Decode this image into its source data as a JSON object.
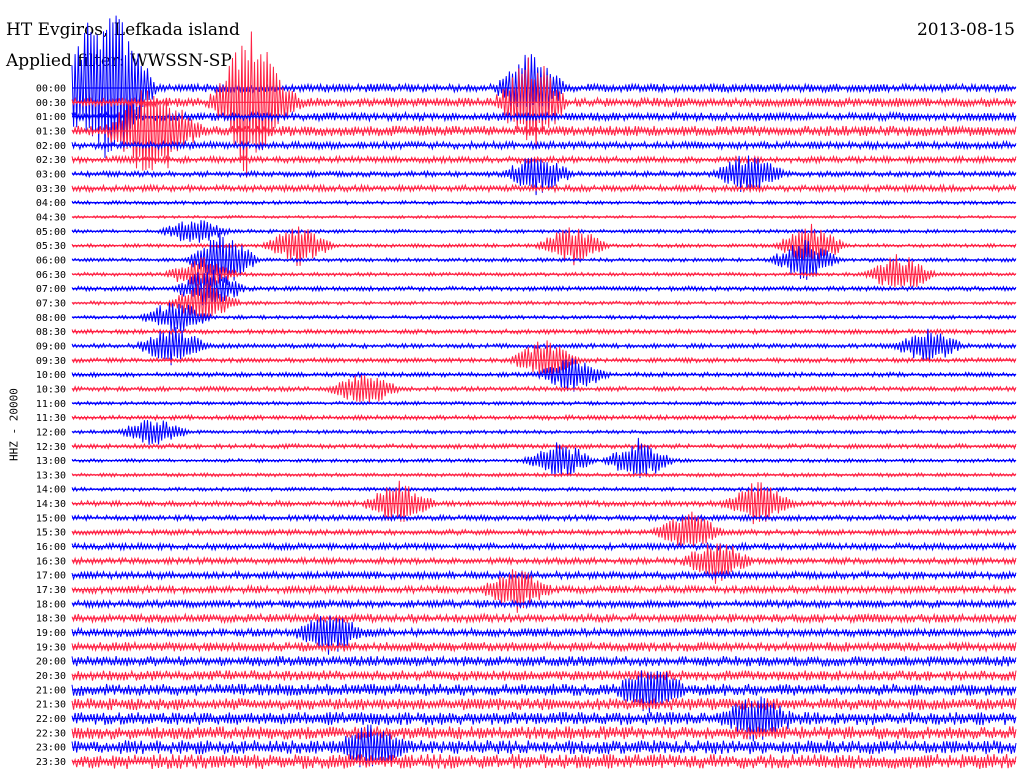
{
  "header": {
    "station": "HT Evgiros, Lefkada island",
    "date": "2013-08-15",
    "filter": "Applied filter: WWSSN-SP"
  },
  "chart_data": {
    "type": "line",
    "title": "HT Evgiros, Lefkada island",
    "ylabel": "HHZ - 20000",
    "row_labels": [
      "00:00",
      "00:30",
      "01:00",
      "01:30",
      "02:00",
      "02:30",
      "03:00",
      "03:30",
      "04:00",
      "04:30",
      "05:00",
      "05:30",
      "06:00",
      "06:30",
      "07:00",
      "07:30",
      "08:00",
      "08:30",
      "09:00",
      "09:30",
      "10:00",
      "10:30",
      "11:00",
      "11:30",
      "12:00",
      "12:30",
      "13:00",
      "13:30",
      "14:00",
      "14:30",
      "15:00",
      "15:30",
      "16:00",
      "16:30",
      "17:00",
      "17:30",
      "18:00",
      "18:30",
      "19:00",
      "19:30",
      "20:00",
      "20:30",
      "21:00",
      "21:30",
      "22:00",
      "22:30",
      "23:00",
      "23:30"
    ],
    "series_colors": [
      "#0000ff",
      "#ff2244"
    ],
    "row_window_minutes": 30,
    "noise_level": [
      0.45,
      0.5,
      0.45,
      0.55,
      0.4,
      0.35,
      0.3,
      0.35,
      0.2,
      0.15,
      0.2,
      0.2,
      0.2,
      0.2,
      0.25,
      0.2,
      0.2,
      0.25,
      0.25,
      0.25,
      0.25,
      0.25,
      0.2,
      0.25,
      0.2,
      0.25,
      0.2,
      0.2,
      0.2,
      0.3,
      0.3,
      0.3,
      0.35,
      0.35,
      0.4,
      0.4,
      0.4,
      0.45,
      0.45,
      0.5,
      0.55,
      0.55,
      0.65,
      0.65,
      0.7,
      0.7,
      0.75,
      0.8
    ],
    "events": [
      {
        "row": 0,
        "minute": 0.5,
        "amp": 8
      },
      {
        "row": 0,
        "minute": 1.5,
        "amp": 6
      },
      {
        "row": 0,
        "minute": 1.5,
        "amp": 5
      },
      {
        "row": 1,
        "minute": 5.5,
        "amp": 9
      },
      {
        "row": 1,
        "minute": 6.2,
        "amp": 4
      },
      {
        "row": 1,
        "minute": 14.6,
        "amp": 7
      },
      {
        "row": 0,
        "minute": 14.6,
        "amp": 5
      },
      {
        "row": 3,
        "minute": 2.2,
        "amp": 5
      },
      {
        "row": 3,
        "minute": 3,
        "amp": 4
      },
      {
        "row": 6,
        "minute": 14.8,
        "amp": 3
      },
      {
        "row": 6,
        "minute": 21.5,
        "amp": 3
      },
      {
        "row": 10,
        "minute": 3.9,
        "amp": 2
      },
      {
        "row": 11,
        "minute": 7.2,
        "amp": 3
      },
      {
        "row": 12,
        "minute": 4.8,
        "amp": 4
      },
      {
        "row": 13,
        "minute": 4.1,
        "amp": 2.5
      },
      {
        "row": 14,
        "minute": 4.4,
        "amp": 3
      },
      {
        "row": 15,
        "minute": 4.2,
        "amp": 3
      },
      {
        "row": 11,
        "minute": 15.9,
        "amp": 3
      },
      {
        "row": 11,
        "minute": 23.5,
        "amp": 3
      },
      {
        "row": 12,
        "minute": 23.3,
        "amp": 3
      },
      {
        "row": 13,
        "minute": 26.3,
        "amp": 3
      },
      {
        "row": 16,
        "minute": 3.3,
        "amp": 2.5
      },
      {
        "row": 18,
        "minute": 3.2,
        "amp": 3
      },
      {
        "row": 20,
        "minute": 15.9,
        "amp": 2.5
      },
      {
        "row": 19,
        "minute": 15,
        "amp": 3
      },
      {
        "row": 18,
        "minute": 27.2,
        "amp": 2.5
      },
      {
        "row": 21,
        "minute": 9.3,
        "amp": 2.5
      },
      {
        "row": 24,
        "minute": 2.6,
        "amp": 2
      },
      {
        "row": 26,
        "minute": 15.5,
        "amp": 3
      },
      {
        "row": 26,
        "minute": 18,
        "amp": 3
      },
      {
        "row": 29,
        "minute": 10.4,
        "amp": 3
      },
      {
        "row": 29,
        "minute": 21.8,
        "amp": 3
      },
      {
        "row": 31,
        "minute": 19.6,
        "amp": 3
      },
      {
        "row": 33,
        "minute": 20.5,
        "amp": 3
      },
      {
        "row": 35,
        "minute": 14.1,
        "amp": 3
      },
      {
        "row": 38,
        "minute": 8.2,
        "amp": 3
      },
      {
        "row": 42,
        "minute": 18.4,
        "amp": 3
      },
      {
        "row": 44,
        "minute": 21.8,
        "amp": 3
      },
      {
        "row": 46,
        "minute": 9.5,
        "amp": 3
      }
    ]
  }
}
